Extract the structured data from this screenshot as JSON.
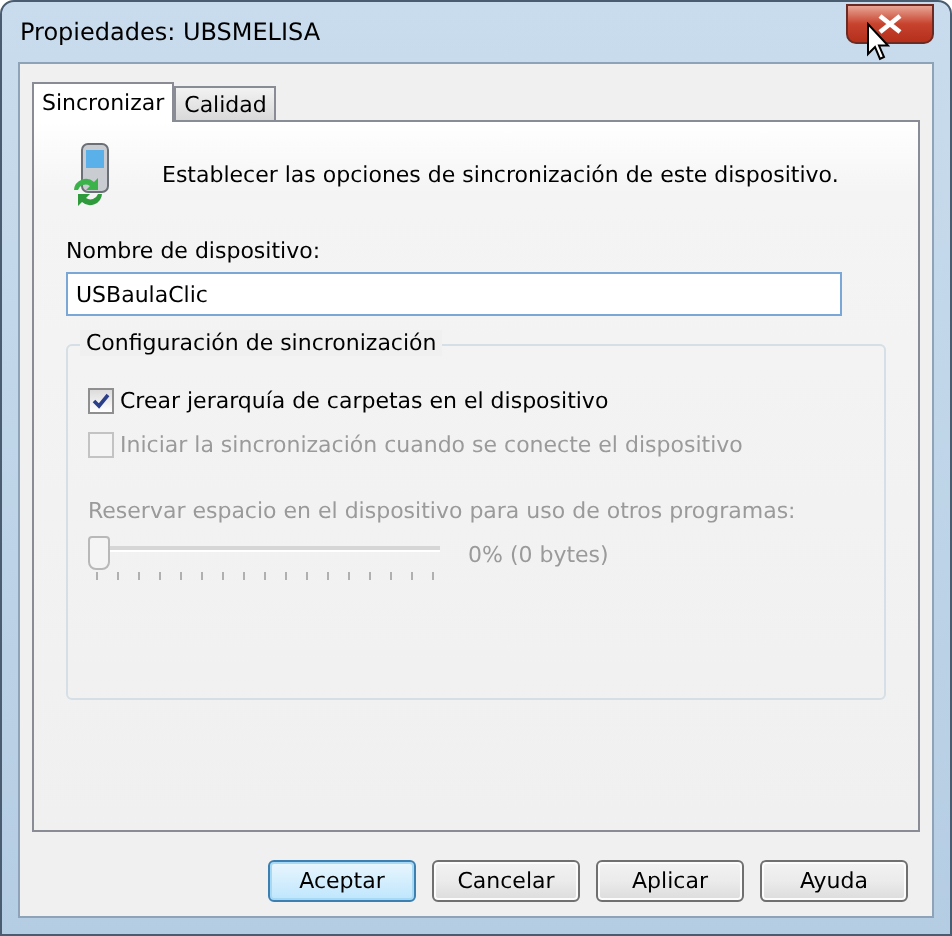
{
  "window": {
    "title": "Propiedades: UBSMELISA"
  },
  "tabs": [
    {
      "label": "Sincronizar",
      "selected": true
    },
    {
      "label": "Calidad",
      "selected": false
    }
  ],
  "intro": "Establecer las opciones de sincronización de este dispositivo.",
  "device_name": {
    "label": "Nombre de dispositivo:",
    "value": "USBaulaClic"
  },
  "sync_group": {
    "title": "Configuración de sincronización",
    "options": [
      {
        "label": "Crear jerarquía de carpetas en el dispositivo",
        "checked": true,
        "disabled": false
      },
      {
        "label": "Iniciar la sincronización cuando se conecte el dispositivo",
        "checked": false,
        "disabled": true
      }
    ],
    "reserve": {
      "label": "Reservar espacio en el dispositivo para uso de otros programas:",
      "level": 0,
      "reading": "0% (0 bytes)",
      "disabled": true
    }
  },
  "buttons": [
    {
      "label": "Aceptar",
      "default": true
    },
    {
      "label": "Cancelar",
      "default": false
    },
    {
      "label": "Aplicar",
      "default": false
    },
    {
      "label": "Ayuda",
      "default": false
    }
  ]
}
